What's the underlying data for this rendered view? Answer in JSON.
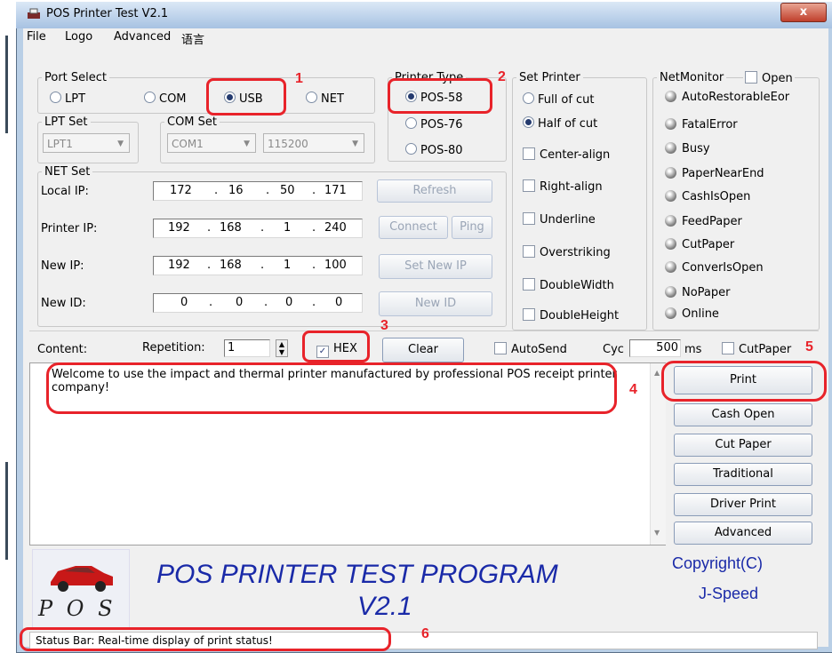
{
  "window": {
    "title": "POS Printer Test V2.1",
    "close_glyph": "x"
  },
  "menu": [
    "File",
    "Logo",
    "Advanced",
    "语言"
  ],
  "port_select": {
    "legend": "Port Select",
    "options": [
      {
        "label": "LPT",
        "selected": false
      },
      {
        "label": "COM",
        "selected": false
      },
      {
        "label": "USB",
        "selected": true
      },
      {
        "label": "NET",
        "selected": false
      }
    ]
  },
  "lpt_set": {
    "legend": "LPT Set",
    "value": "LPT1"
  },
  "com_set": {
    "legend": "COM Set",
    "port": "COM1",
    "baud": "115200"
  },
  "printer_type": {
    "legend": "Printer Type",
    "options": [
      {
        "label": "POS-58",
        "selected": true
      },
      {
        "label": "POS-76",
        "selected": false
      },
      {
        "label": "POS-80",
        "selected": false
      }
    ]
  },
  "set_printer": {
    "legend": "Set Printer",
    "cut_options": [
      {
        "label": "Full of cut",
        "selected": false
      },
      {
        "label": "Half of cut",
        "selected": true
      }
    ],
    "checks": [
      "Center-align",
      "Right-align",
      "Underline",
      "Overstriking",
      "DoubleWidth",
      "DoubleHeight"
    ]
  },
  "net_monitor": {
    "legend": "NetMonitor",
    "open_label": "Open",
    "items": [
      "AutoRestorableEor",
      "FatalError",
      "Busy",
      "PaperNearEnd",
      "CashIsOpen",
      "FeedPaper",
      "CutPaper",
      "ConverIsOpen",
      "NoPaper",
      "Online"
    ]
  },
  "net_set": {
    "legend": "NET Set",
    "rows": [
      {
        "label": "Local IP:",
        "ip": [
          "172",
          "16",
          "50",
          "171"
        ],
        "button": "Refresh"
      },
      {
        "label": "Printer IP:",
        "ip": [
          "192",
          "168",
          "1",
          "240"
        ],
        "button": "Connect",
        "button2": "Ping"
      },
      {
        "label": "New IP:",
        "ip": [
          "192",
          "168",
          "1",
          "100"
        ],
        "button": "Set New IP"
      },
      {
        "label": "New ID:",
        "ip": [
          "0",
          "0",
          "0",
          "0"
        ],
        "button": "New ID"
      }
    ]
  },
  "content_bar": {
    "content_label": "Content:",
    "repetition_label": "Repetition:",
    "repetition_value": "1",
    "hex_label": "HEX",
    "hex_checked": true,
    "clear_label": "Clear",
    "autosend_label": "AutoSend",
    "cyc_label": "Cyc",
    "cyc_value": "500",
    "ms_label": "ms",
    "cutpaper_label": "CutPaper"
  },
  "content_text": "Welcome to use the impact and thermal printer manufactured by professional POS receipt printer company!",
  "side_buttons": [
    "Print",
    "Cash Open",
    "Cut Paper",
    "Traditional",
    "Driver Print",
    "Advanced"
  ],
  "banner": {
    "logo_text": "P O S",
    "title_line1": "POS PRINTER TEST PROGRAM",
    "title_line2": "V2.1",
    "copyright": "Copyright(C)",
    "author": "J-Speed"
  },
  "status_bar": "Status Bar: Real-time display of print status!",
  "annotations": [
    "1",
    "2",
    "3",
    "4",
    "5",
    "6"
  ],
  "colors": {
    "annotation_red": "#e8232a",
    "banner_blue": "#1a2aa8",
    "window_frame": "#b9cfe6"
  }
}
